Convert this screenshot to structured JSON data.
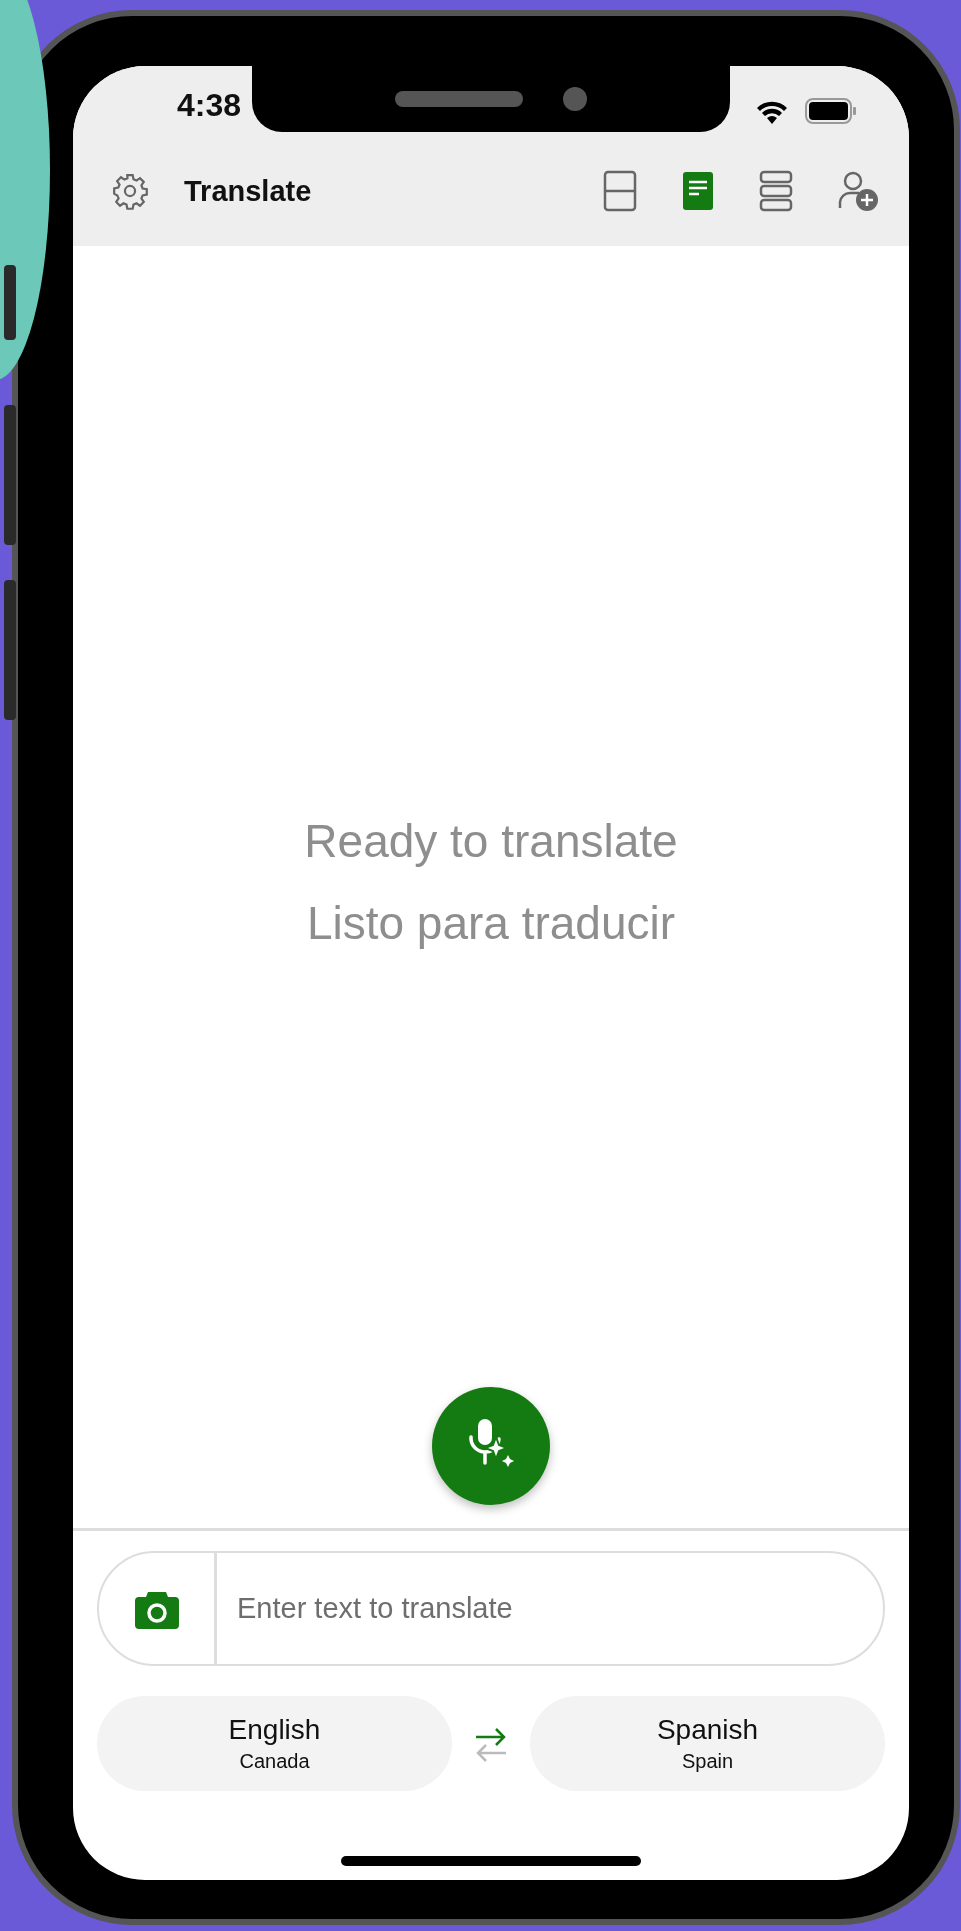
{
  "status_bar": {
    "time": "4:38"
  },
  "toolbar": {
    "title": "Translate",
    "view_modes": [
      {
        "kind": "split",
        "selected": false
      },
      {
        "kind": "document",
        "selected": true
      },
      {
        "kind": "stacked",
        "selected": false
      }
    ]
  },
  "empty_state": {
    "lines": [
      "Ready to translate",
      "Listo para traducir"
    ]
  },
  "input": {
    "placeholder": "Enter text to translate"
  },
  "languages": [
    {
      "name": "English",
      "region": "Canada"
    },
    {
      "name": "Spanish",
      "region": "Spain"
    }
  ]
}
